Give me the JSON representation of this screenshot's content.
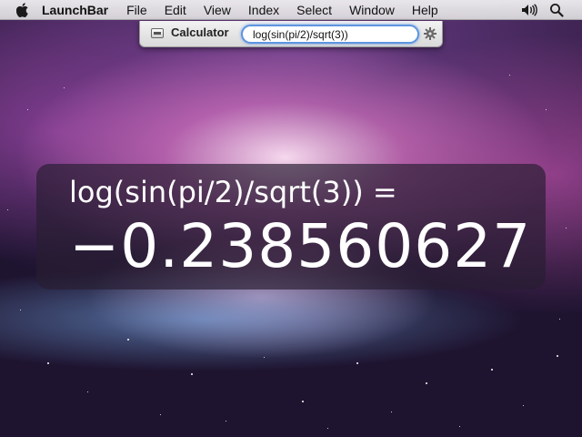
{
  "menubar": {
    "apple_icon": "apple-logo-icon",
    "app_name": "LaunchBar",
    "items": [
      "File",
      "Edit",
      "View",
      "Index",
      "Select",
      "Window",
      "Help"
    ],
    "tray": [
      "volume-icon",
      "spotlight-search-icon"
    ]
  },
  "launchbar": {
    "icon": "calculator-icon",
    "title": "Calculator",
    "input_value": "log(sin(pi/2)/sqrt(3))",
    "action_icon": "gear-icon"
  },
  "large_type": {
    "expression": "log(sin(pi/2)/sqrt(3)) =",
    "result": "−0.238560627"
  }
}
